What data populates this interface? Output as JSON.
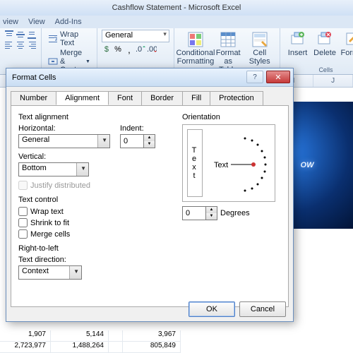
{
  "app": {
    "title": "Cashflow Statement - Microsoft Excel"
  },
  "menu": {
    "items": [
      "view",
      "View",
      "Add-Ins"
    ]
  },
  "ribbon": {
    "wrap_text": "Wrap Text",
    "merge_center": "Merge & Center",
    "number_format": "General",
    "cond_fmt": "Conditional Formatting",
    "fmt_table": "Format as Table",
    "cell_styles": "Cell Styles",
    "insert": "Insert",
    "delete": "Delete",
    "format": "Format",
    "cells_label": "Cells"
  },
  "columns": [
    "",
    "",
    "",
    "",
    "",
    "",
    "",
    "I",
    "J"
  ],
  "data_rows": [
    [
      "1,907",
      "5,144",
      "",
      "3,967"
    ],
    [
      "2,723,977",
      "1,488,264",
      "",
      "805,849"
    ]
  ],
  "image_text": "OW",
  "dialog": {
    "title": "Format Cells",
    "tabs": [
      "Number",
      "Alignment",
      "Font",
      "Border",
      "Fill",
      "Protection"
    ],
    "text_alignment": "Text alignment",
    "horizontal_lbl": "Horizontal:",
    "horizontal_val": "General",
    "vertical_lbl": "Vertical:",
    "vertical_val": "Bottom",
    "indent_lbl": "Indent:",
    "indent_val": "0",
    "justify": "Justify distributed",
    "text_control": "Text control",
    "wrap": "Wrap text",
    "shrink": "Shrink to fit",
    "merge": "Merge cells",
    "rtl": "Right-to-left",
    "text_dir_lbl": "Text direction:",
    "text_dir_val": "Context",
    "orientation": "Orientation",
    "orient_text": "Text",
    "degrees_lbl": "Degrees",
    "degrees_val": "0",
    "ok": "OK",
    "cancel": "Cancel"
  }
}
